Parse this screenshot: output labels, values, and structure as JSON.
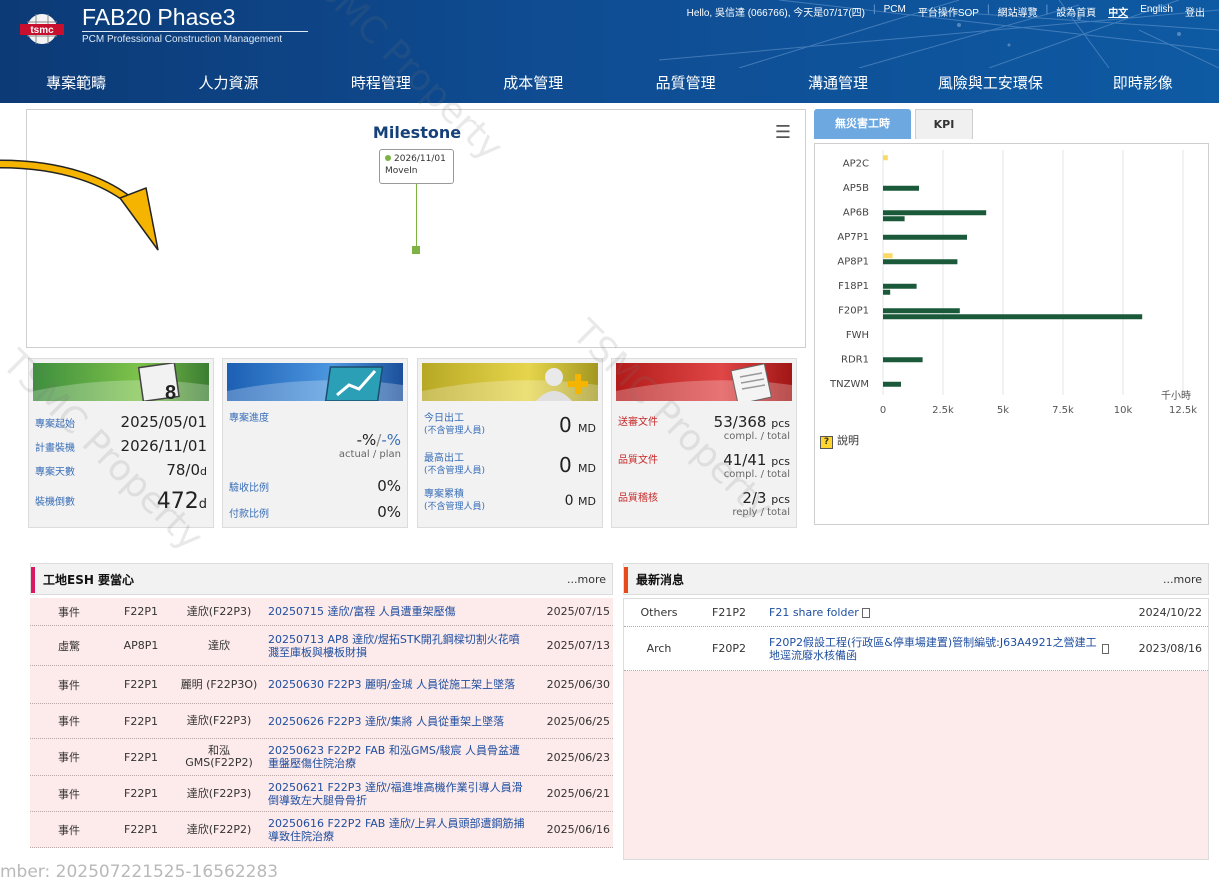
{
  "header": {
    "title": "FAB20 Phase3",
    "subtitle": "PCM Professional Construction Management",
    "logo_text": "tsmc",
    "greeting": "Hello, 吳信達 (066766), 今天是07/17(四)",
    "links": [
      "PCM",
      "平台操作SOP",
      "網站導覽",
      "設為首頁",
      "中文",
      "English",
      "登出"
    ]
  },
  "nav": [
    "專案範疇",
    "人力資源",
    "時程管理",
    "成本管理",
    "品質管理",
    "溝通管理",
    "風險與工安環保",
    "即時影像"
  ],
  "milestone": {
    "title": "Milestone",
    "tooltip_date": "2026/11/01",
    "tooltip_label": "MoveIn",
    "colors": {
      "marker": "#7cb342"
    }
  },
  "cards": {
    "schedule": {
      "rows": [
        {
          "label": "專案起始",
          "value": "2025/05/01"
        },
        {
          "label": "計畫裝機",
          "value": "2026/11/01"
        },
        {
          "label": "專案天數",
          "value": "78/0",
          "unit": "d"
        },
        {
          "label": "裝機倒數",
          "value": "472",
          "unit": "d"
        }
      ]
    },
    "progress": {
      "label": "專案進度",
      "value_actual": "-%",
      "value_sep": "/",
      "value_plan": "-%",
      "value_sub": "actual / plan",
      "accept_label": "驗收比例",
      "accept_value": "0%",
      "pay_label": "付款比例",
      "pay_value": "0%"
    },
    "manpower": {
      "rows": [
        {
          "label": "今日出工",
          "sub": "(不含管理人員)",
          "value": "0",
          "unit": "MD"
        },
        {
          "label": "最高出工",
          "sub": "(不含管理人員)",
          "value": "0",
          "unit": "MD"
        },
        {
          "label": "專案累積",
          "sub": "(不含管理人員)",
          "value": "0",
          "unit": "MD"
        }
      ]
    },
    "documents": {
      "rows": [
        {
          "label": "送審文件",
          "value": "53/368",
          "unit": "pcs",
          "sub": "compl. / total"
        },
        {
          "label": "品質文件",
          "value": "41/41",
          "unit": "pcs",
          "sub": "compl. / total"
        },
        {
          "label": "品質稽核",
          "value": "2/3",
          "unit": "pcs",
          "sub": "reply / total"
        }
      ]
    }
  },
  "kpi": {
    "tabs": [
      "無災害工時",
      "KPI"
    ],
    "help_label": "說明",
    "colors": {
      "dark": "#1a5a3a",
      "light": "#fcd966"
    }
  },
  "chart_data": {
    "type": "bar",
    "orientation": "horizontal",
    "categories": [
      "AP2C",
      "AP5B",
      "AP6B",
      "AP7P1",
      "AP8P1",
      "F18P1",
      "F20P1",
      "FWH",
      "RDR1",
      "TNZWM"
    ],
    "series": [
      {
        "values": [
          200,
          0,
          0,
          0,
          400,
          0,
          0,
          0,
          0,
          0
        ]
      },
      {
        "values": [
          0,
          1500,
          4300,
          3500,
          3100,
          1400,
          3200,
          0,
          1650,
          750
        ]
      },
      {
        "values": [
          0,
          0,
          900,
          0,
          0,
          300,
          10800,
          0,
          0,
          0
        ]
      }
    ],
    "xlim": [
      0,
      12500
    ],
    "xticks": [
      "0",
      "2.5k",
      "5k",
      "7.5k",
      "10k",
      "12.5k"
    ],
    "xunit": "千小時",
    "grid": true
  },
  "esh": {
    "title": "工地ESH 要當心",
    "more": "...more",
    "rows": [
      {
        "type": "事件",
        "area": "F22P1",
        "who": "達欣(F22P3)",
        "title": "20250715 達欣/富程 人員遭重架壓傷",
        "date": "2025/07/15"
      },
      {
        "type": "虛驚",
        "area": "AP8P1",
        "who": "達欣",
        "title": "20250713 AP8 達欣/煜拓STK開孔鋼樑切割火花噴濺至庫板與樓板財損",
        "date": "2025/07/13"
      },
      {
        "type": "事件",
        "area": "F22P1",
        "who": "麗明 (F22P3O)",
        "title": "20250630 F22P3 麗明/金珹 人員從施工架上墜落",
        "date": "2025/06/30"
      },
      {
        "type": "事件",
        "area": "F22P1",
        "who": "達欣(F22P3)",
        "title": "20250626 F22P3 達欣/集將 人員從重架上墜落",
        "date": "2025/06/25"
      },
      {
        "type": "事件",
        "area": "F22P1",
        "who": "和泓 GMS(F22P2)",
        "title": "20250623 F22P2 FAB 和泓GMS/駿宸 人員骨盆遭重盤壓傷住院治療",
        "date": "2025/06/23"
      },
      {
        "type": "事件",
        "area": "F22P1",
        "who": "達欣(F22P3)",
        "title": "20250621 F22P3 達欣/福進堆高機作業引導人員滑倒導致左大腿骨骨折",
        "date": "2025/06/21"
      },
      {
        "type": "事件",
        "area": "F22P1",
        "who": "達欣(F22P2)",
        "title": "20250616 F22P2 FAB 達欣/上昇人員頭部遭鋼筋捕導致住院治療",
        "date": "2025/06/16"
      }
    ]
  },
  "news": {
    "title": "最新消息",
    "more": "...more",
    "rows": [
      {
        "cat": "Others",
        "area": "F21P2",
        "title": "F21 share folder",
        "date": "2024/10/22"
      },
      {
        "cat": "Arch",
        "area": "F20P2",
        "title": "F20P2假設工程(行政區&停車場建置)管制編號:J63A4921之營建工地逕流廢水核備函",
        "date": "2023/08/16"
      }
    ]
  },
  "footer": {
    "serial": "mber: 202507221525-16562283"
  },
  "watermark_text": "TSMC Property",
  "colors": {
    "header_bg": "#0f4c92",
    "link": "#1f4fa0",
    "esh_accent": "#d81b60",
    "news_accent": "#e64a19",
    "row_pink": "#fdeaea"
  }
}
